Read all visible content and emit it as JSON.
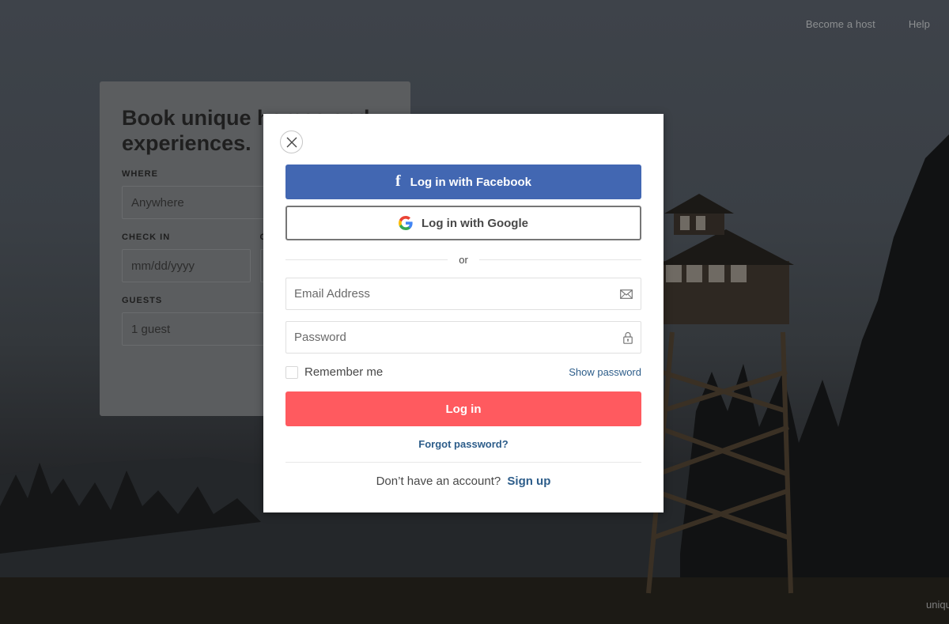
{
  "nav": {
    "become_host": "Become a host",
    "help": "Help"
  },
  "search_card": {
    "heading": "Book unique homes and experiences.",
    "where_label": "WHERE",
    "where_placeholder": "Anywhere",
    "checkin_label": "CHECK IN",
    "checkin_placeholder": "mm/dd/yyyy",
    "checkout_label_partial": "C",
    "guests_label": "GUESTS",
    "guests_value": "1 guest"
  },
  "corner_text": "uniqu",
  "modal": {
    "facebook_label": "Log in with Facebook",
    "google_label": "Log in with Google",
    "divider_text": "or",
    "email_placeholder": "Email Address",
    "password_placeholder": "Password",
    "remember_label": "Remember me",
    "show_password": "Show password",
    "login_label": "Log in",
    "forgot_label": "Forgot password?",
    "no_account_text": "Don’t have an account?",
    "signup_label": "Sign up"
  },
  "colors": {
    "facebook": "#4267b2",
    "login": "#ff5a5f",
    "link": "#2d5d8a"
  }
}
